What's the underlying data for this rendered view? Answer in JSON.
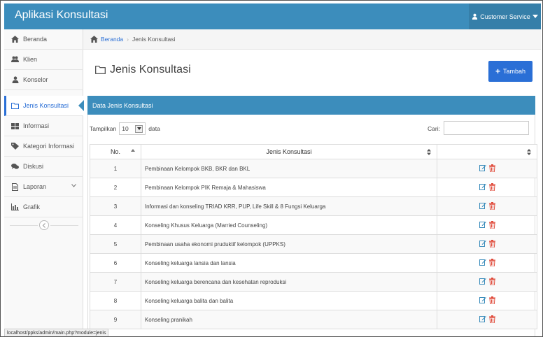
{
  "app": {
    "title": "Aplikasi Konsultasi"
  },
  "user_menu": {
    "label": "Customer Service"
  },
  "sidebar": {
    "items": [
      {
        "label": "Beranda",
        "icon": "home-icon"
      },
      {
        "label": "Klien",
        "icon": "users-icon"
      },
      {
        "label": "Konselor",
        "icon": "user-icon"
      },
      {
        "label": "Jenis Konsultasi",
        "icon": "folder-icon",
        "active": true
      },
      {
        "label": "Informasi",
        "icon": "grid-icon"
      },
      {
        "label": "Kategori Informasi",
        "icon": "tag-icon"
      },
      {
        "label": "Diskusi",
        "icon": "chat-icon"
      },
      {
        "label": "Laporan",
        "icon": "file-icon",
        "has_submenu": true
      },
      {
        "label": "Grafik",
        "icon": "bar-chart-icon"
      }
    ]
  },
  "breadcrumb": {
    "home": "Beranda",
    "current": "Jenis Konsultasi"
  },
  "page": {
    "title": "Jenis Konsultasi",
    "add_button": "Tambah"
  },
  "panel": {
    "title": "Data Jenis Konsultasi",
    "show_label": "Tampilkan",
    "show_value": "10",
    "show_suffix": "data",
    "search_label": "Cari:",
    "search_value": ""
  },
  "table": {
    "columns": [
      "No.",
      "Jenis Konsultasi",
      ""
    ],
    "rows": [
      {
        "no": "1",
        "name": "Pembinaan Kelompok BKB, BKR dan BKL"
      },
      {
        "no": "2",
        "name": "Pembinaan Kelompok PIK Remaja & Mahasiswa"
      },
      {
        "no": "3",
        "name": "Informasi dan konseling TRIAD KRR, PUP, Life Skill & 8 Fungsi Keluarga"
      },
      {
        "no": "4",
        "name": "Konseling Khusus Keluarga (Married Counseling)"
      },
      {
        "no": "5",
        "name": "Pembinaan usaha ekonomi pruduktif kelompok (UPPKS)"
      },
      {
        "no": "6",
        "name": "Konseling keluarga lansia dan lansia"
      },
      {
        "no": "7",
        "name": "Konseling keluarga berencana dan kesehatan reproduksi"
      },
      {
        "no": "8",
        "name": "Konseling keluarga balita dan balita"
      },
      {
        "no": "9",
        "name": "Konseling pranikah"
      }
    ]
  },
  "status_bar": {
    "url": "localhost/ppks/admin/main.php?module=jenis"
  },
  "colors": {
    "primary": "#3c8dbc",
    "button": "#2a6fd6",
    "delete": "#e04a3a"
  }
}
